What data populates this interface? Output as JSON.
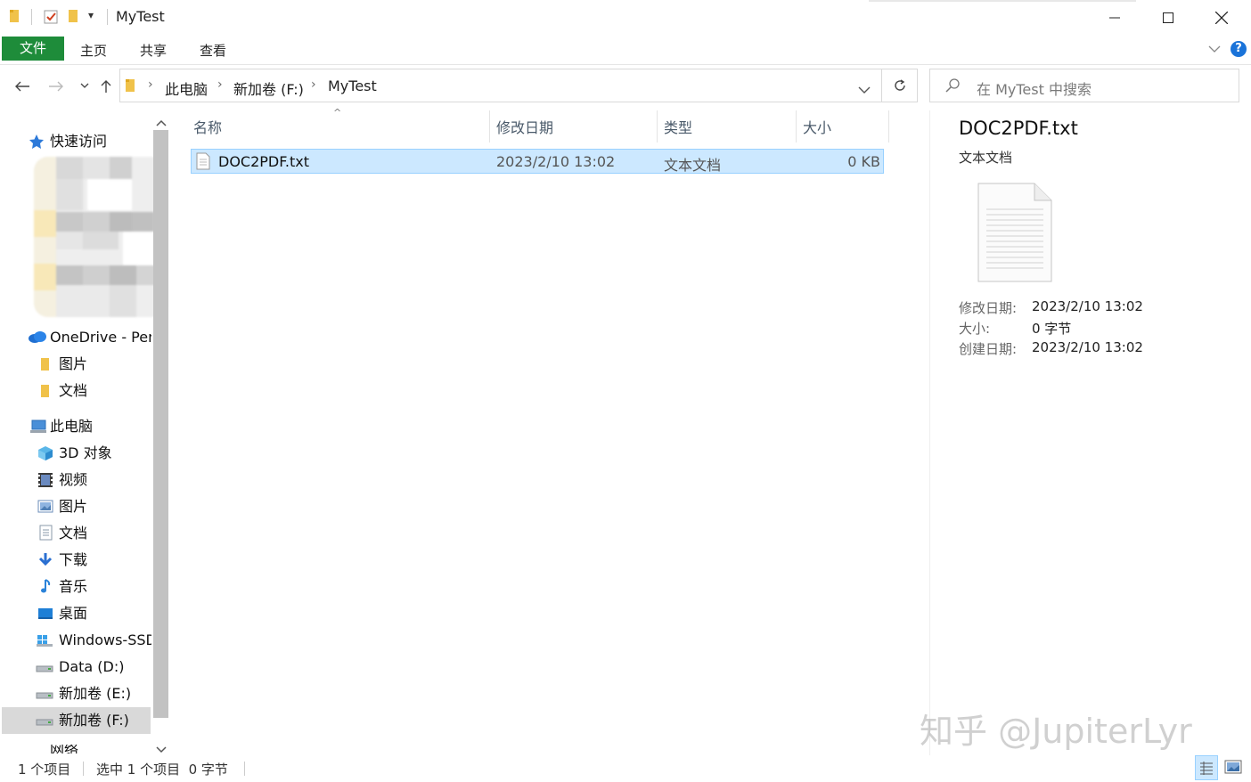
{
  "window": {
    "title": "MyTest",
    "minimize": "—",
    "maximize": "☐",
    "close": "✕"
  },
  "ribbon": {
    "tabs": [
      "文件",
      "主页",
      "共享",
      "查看"
    ]
  },
  "address": {
    "path": [
      "此电脑",
      "新加卷 (F:)",
      "MyTest"
    ]
  },
  "search": {
    "placeholder": "在 MyTest 中搜索"
  },
  "nav": {
    "quick_access": "快速访问",
    "onedrive": "OneDrive - Per",
    "onedrive_items": [
      "图片",
      "文档"
    ],
    "this_pc": "此电脑",
    "pc_items": [
      "3D 对象",
      "视频",
      "图片",
      "文档",
      "下载",
      "音乐",
      "桌面",
      "Windows-SSD",
      "Data (D:)",
      "新加卷 (E:)",
      "新加卷 (F:)"
    ],
    "network": "网络"
  },
  "columns": {
    "name": "名称",
    "modified": "修改日期",
    "type": "类型",
    "size": "大小"
  },
  "files": [
    {
      "name": "DOC2PDF.txt",
      "modified": "2023/2/10 13:02",
      "type": "文本文档",
      "size": "0 KB"
    }
  ],
  "details": {
    "filename": "DOC2PDF.txt",
    "filetype": "文本文档",
    "modified_label": "修改日期:",
    "modified_value": "2023/2/10 13:02",
    "size_label": "大小:",
    "size_value": "0 字节",
    "created_label": "创建日期:",
    "created_value": "2023/2/10 13:02"
  },
  "status": {
    "count": "1 个项目",
    "selected": "选中 1 个项目  0 字节"
  },
  "watermark": "知乎 @JupiterLyr",
  "colors": {
    "accent_file_tab": "#1e8c3a",
    "selection": "#cce8ff",
    "selection_border": "#99d1ff"
  }
}
